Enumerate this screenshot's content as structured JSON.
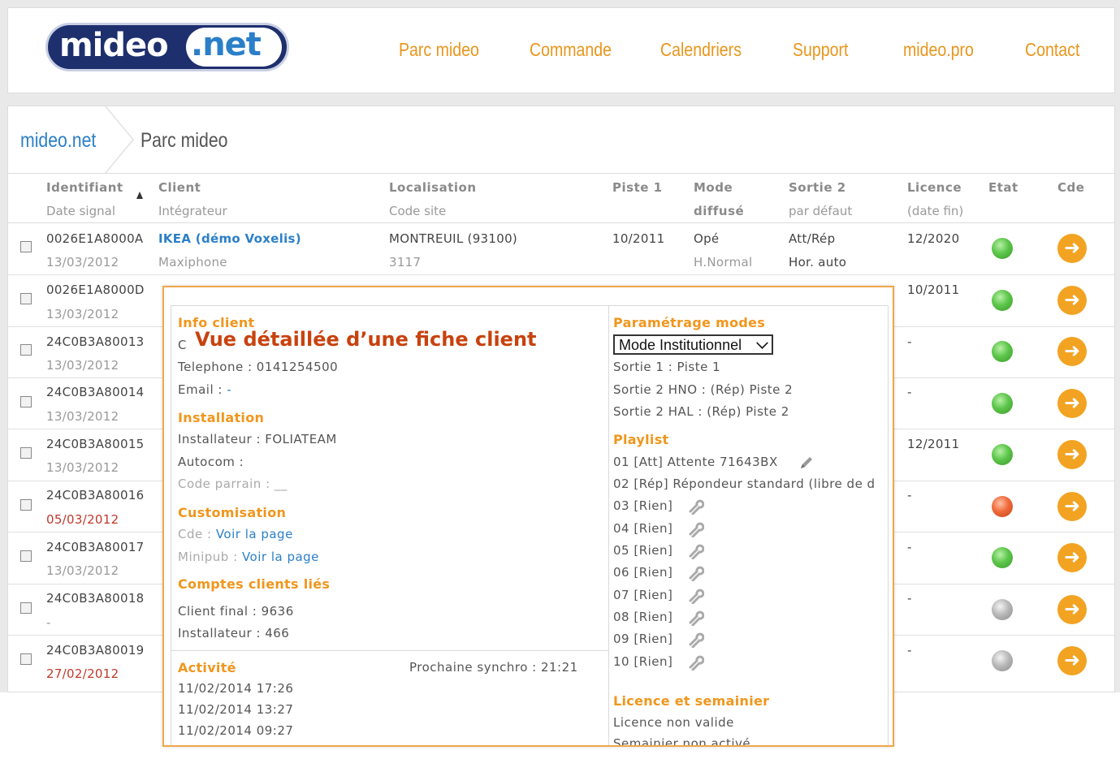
{
  "nav": {
    "logo_part1": "mideo",
    "logo_part2": ".net",
    "items": [
      "Parc mideo",
      "Commande",
      "Calendriers",
      "Support",
      "mideo.pro",
      "Contact"
    ]
  },
  "breadcrumb": {
    "home": "mideo.net",
    "current": "Parc mideo"
  },
  "table": {
    "headers": [
      {
        "top": "Identifiant",
        "bottom": "Date signal"
      },
      {
        "top": "Client",
        "bottom": "Intégrateur"
      },
      {
        "top": "Localisation",
        "bottom": "Code site"
      },
      {
        "top": "Piste 1",
        "bottom": ""
      },
      {
        "top": "Mode",
        "bottom": "diffusé"
      },
      {
        "top": "Sortie 2",
        "bottom": "par défaut"
      },
      {
        "top": "Licence",
        "bottom": "(date fin)"
      },
      {
        "top": "Etat",
        "bottom": ""
      },
      {
        "top": "Cde",
        "bottom": ""
      }
    ],
    "rows": [
      {
        "id": "0026E1A8000A",
        "date": "13/03/2012",
        "client": "IKEA (démo Voxelis)",
        "integrator": "Maxiphone",
        "location": "MONTREUIL (93100)",
        "site": "3117",
        "piste": "10/2011",
        "mode": "Opé",
        "mode2": "H.Normal",
        "sortie": "Att/Rép",
        "sortie2": "Hor. auto",
        "licence": "12/2020",
        "state": "green"
      },
      {
        "id": "0026E1A8000D",
        "date": "13/03/2012",
        "licence": "10/2011",
        "state": "green"
      },
      {
        "id": "24C0B3A80013",
        "date": "13/03/2012",
        "licence": "-",
        "state": "green"
      },
      {
        "id": "24C0B3A80014",
        "date": "13/03/2012",
        "licence": "-",
        "state": "green"
      },
      {
        "id": "24C0B3A80015",
        "date": "13/03/2012",
        "licence": "12/2011",
        "state": "green"
      },
      {
        "id": "24C0B3A80016",
        "date": "05/03/2012",
        "licence": "-",
        "state": "red"
      },
      {
        "id": "24C0B3A80017",
        "date": "13/03/2012",
        "licence": "-",
        "state": "green"
      },
      {
        "id": "24C0B3A80018",
        "date": "-",
        "licence": "-",
        "state": "grey"
      },
      {
        "id": "24C0B3A80019",
        "date": "27/02/2012",
        "licence": "-",
        "state": "grey"
      }
    ],
    "cde_symbol": "➜"
  },
  "popup": {
    "title": "Vue détaillée d’une fiche client",
    "info": {
      "heading": "Info client",
      "contact_initial": "C",
      "phone": "Telephone : 0141254500",
      "email_label": "Email : ",
      "email_value": "-"
    },
    "installation": {
      "heading": "Installation",
      "installer": "Installateur : FOLIATEAM",
      "autocom": "Autocom :",
      "code": "Code parrain : __"
    },
    "customisation": {
      "heading": "Customisation",
      "cde_label": "Cde : ",
      "cde_link": "Voir la page",
      "minipub_label": "Minipub : ",
      "minipub_link": "Voir la page"
    },
    "accounts": {
      "heading": "Comptes clients liés",
      "final": "Client final : 9636",
      "installer": "Installateur : 466"
    },
    "activity": {
      "heading": "Activité",
      "next_sync": "Prochaine synchro : 21:21",
      "entries": [
        "11/02/2014 17:26",
        "11/02/2014 13:27",
        "11/02/2014 09:27"
      ]
    },
    "modes": {
      "heading": "Paramétrage modes",
      "selected": "Mode Institutionnel",
      "lines": [
        "Sortie 1 : Piste 1",
        "Sortie 2 HNO : (Rép) Piste 2",
        "Sortie 2 HAL : (Rép) Piste 2"
      ]
    },
    "playlist": {
      "heading": "Playlist",
      "items": [
        "01 [Att] Attente 71643BX",
        "02 [Rép] Répondeur standard (libre de d",
        "03 [Rien]",
        "04 [Rien]",
        "05 [Rien]",
        "06 [Rien]",
        "07 [Rien]",
        "08 [Rien]",
        "09 [Rien]",
        "10 [Rien]"
      ]
    },
    "licence": {
      "heading": "Licence et semainier",
      "line1": "Licence non valide",
      "line2": "Semainier non activé"
    }
  },
  "colors": {
    "nav": "#e8961c",
    "link": "#2b7fc8",
    "popup_border": "#f0a64a",
    "popup_title": "#c8420e",
    "date_red": "#c0392b"
  }
}
